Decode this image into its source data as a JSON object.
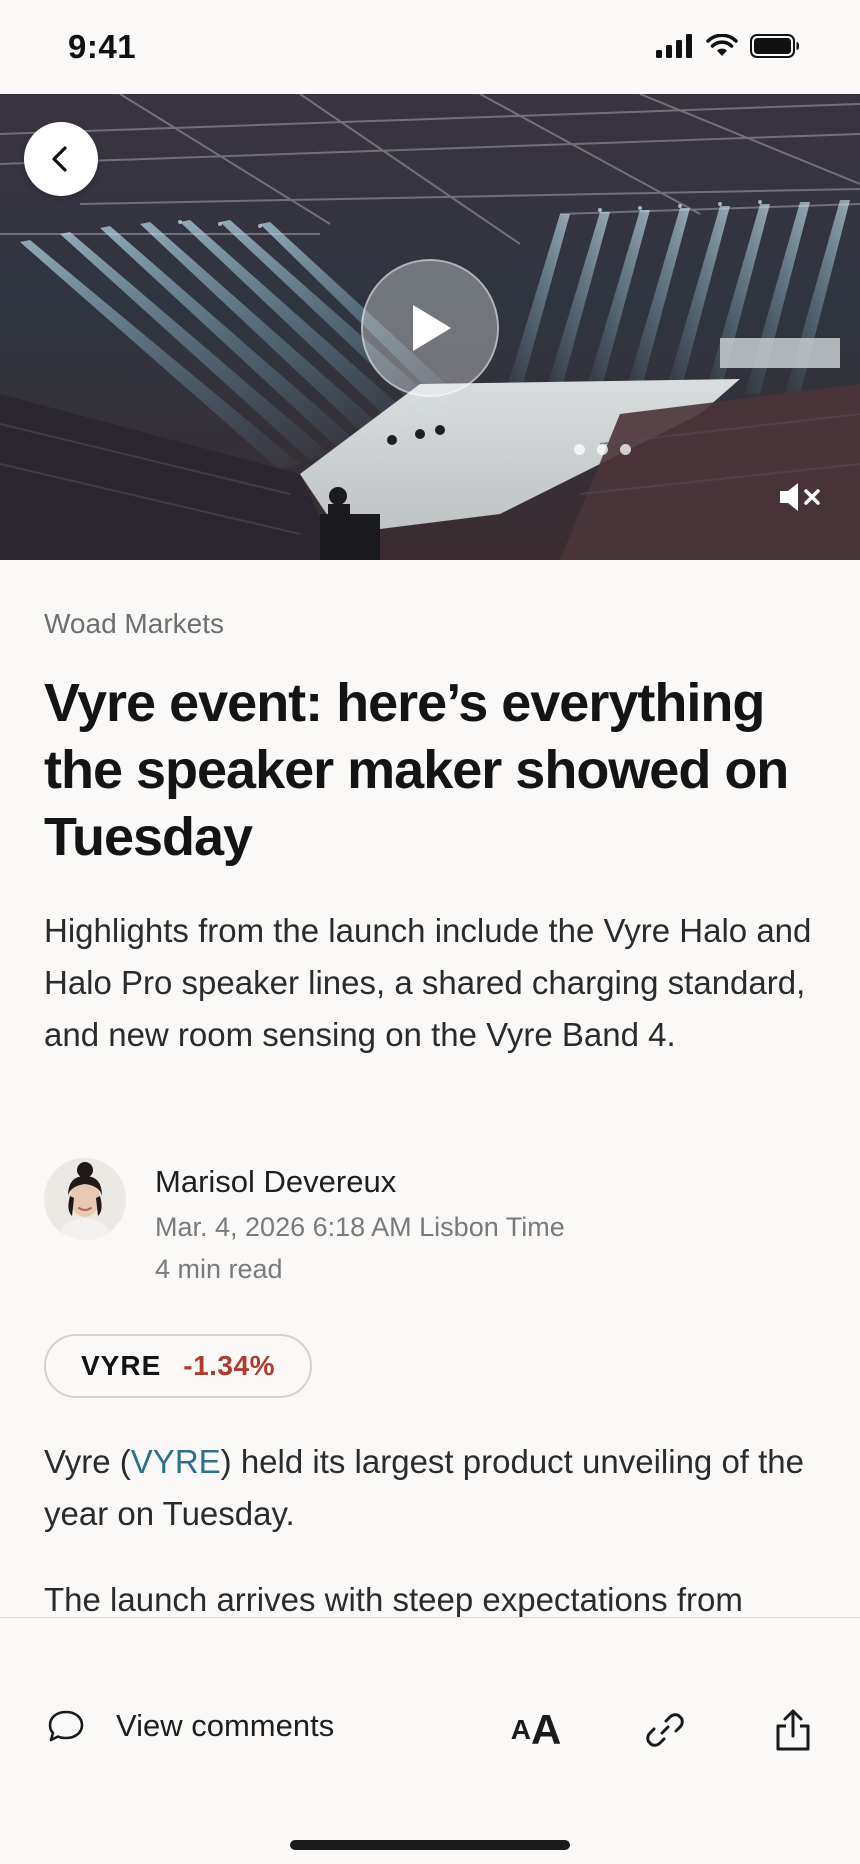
{
  "status_bar": {
    "time": "9:41",
    "icons": [
      "signal-icon",
      "wifi-icon",
      "battery-icon"
    ]
  },
  "hero": {
    "icons": [
      "back-icon",
      "play-icon",
      "mute-icon"
    ],
    "carousel_dots": 3
  },
  "article": {
    "source": "Woad Markets",
    "headline": "Vyre event: here’s everything the speaker maker showed on Tuesday",
    "dek": "Highlights from the launch include the Vyre Halo and Halo Pro speaker lines, a shared charging standard, and new room sensing on the Vyre Band 4.",
    "author": "Marisol Devereux",
    "date": "Mar. 4, 2026 6:18 AM Lisbon Time",
    "read_time": "4 min read",
    "ticker": {
      "symbol": "VYRE",
      "change": "-1.34%",
      "change_color": "#B03A2E"
    },
    "body": {
      "p1_before": "Vyre (",
      "p1_link": "VYRE",
      "p1_after": ") held its largest product unveiling of the year on Tuesday.",
      "p2": "The launch arrives with steep expectations from"
    }
  },
  "toolbar": {
    "comments_label": "View comments",
    "text_size_small": "A",
    "text_size_large": "A",
    "icons": [
      "comment-icon",
      "text-size-icon",
      "link-icon",
      "share-icon"
    ]
  },
  "colors": {
    "background": "#FAF9F7",
    "link": "#2E6F8E",
    "negative": "#B03A2E"
  }
}
